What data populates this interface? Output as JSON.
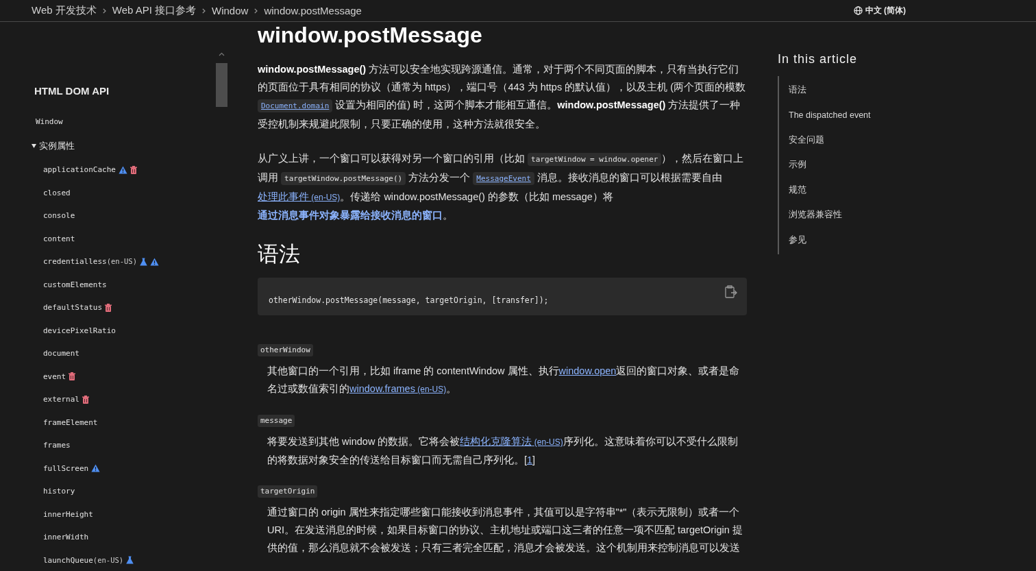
{
  "breadcrumbs": [
    "Web 开发技术",
    "Web API 接口参考",
    "Window",
    "window.postMessage"
  ],
  "language": "中文 (简体)",
  "sidebar": {
    "title": "HTML DOM API",
    "parent": "Window",
    "group": {
      "label": "实例属性",
      "expanded": true,
      "items": [
        {
          "name": "applicationCache",
          "experimental": false,
          "nonstandard": true,
          "deprecated": true
        },
        {
          "name": "closed",
          "experimental": false,
          "nonstandard": false,
          "deprecated": false
        },
        {
          "name": "console",
          "experimental": false,
          "nonstandard": false,
          "deprecated": false
        },
        {
          "name": "content",
          "experimental": false,
          "nonstandard": false,
          "deprecated": false
        },
        {
          "name": "credentialless",
          "note": "(en-US)",
          "experimental": true,
          "nonstandard": true,
          "deprecated": false
        },
        {
          "name": "customElements",
          "experimental": false,
          "nonstandard": false,
          "deprecated": false
        },
        {
          "name": "defaultStatus",
          "experimental": false,
          "nonstandard": false,
          "deprecated": true
        },
        {
          "name": "devicePixelRatio",
          "experimental": false,
          "nonstandard": false,
          "deprecated": false
        },
        {
          "name": "document",
          "experimental": false,
          "nonstandard": false,
          "deprecated": false
        },
        {
          "name": "event",
          "experimental": false,
          "nonstandard": false,
          "deprecated": true
        },
        {
          "name": "external",
          "experimental": false,
          "nonstandard": false,
          "deprecated": true
        },
        {
          "name": "frameElement",
          "experimental": false,
          "nonstandard": false,
          "deprecated": false
        },
        {
          "name": "frames",
          "experimental": false,
          "nonstandard": false,
          "deprecated": false
        },
        {
          "name": "fullScreen",
          "experimental": false,
          "nonstandard": true,
          "deprecated": false
        },
        {
          "name": "history",
          "experimental": false,
          "nonstandard": false,
          "deprecated": false
        },
        {
          "name": "innerHeight",
          "experimental": false,
          "nonstandard": false,
          "deprecated": false
        },
        {
          "name": "innerWidth",
          "experimental": false,
          "nonstandard": false,
          "deprecated": false
        },
        {
          "name": "launchQueue",
          "note": "(en-US)",
          "experimental": true,
          "nonstandard": false,
          "deprecated": false
        }
      ]
    }
  },
  "article": {
    "title": "window.postMessage",
    "intro": [
      [
        {
          "kind": "bold",
          "text": "window.postMessage()"
        },
        {
          "kind": "text",
          "text": " 方法可以安全地实现跨源通信。通常，对于两个不同页面的脚本，只有当执行它们的页面位于具有相同的协议（通常为 https），端口号（443 为 https 的默认值），以及主机 (两个页面的模数 "
        },
        {
          "kind": "codelink",
          "text": "Document.domain"
        },
        {
          "kind": "text",
          "text": " 设置为相同的值) 时，这两个脚本才能相互通信。"
        },
        {
          "kind": "bold",
          "text": "window.postMessage()"
        },
        {
          "kind": "text",
          "text": " 方法提供了一种受控机制来规避此限制，只要正确的使用，这种方法就很安全。"
        }
      ],
      [
        {
          "kind": "text",
          "text": "从广义上讲，一个窗口可以获得对另一个窗口的引用（比如 "
        },
        {
          "kind": "code",
          "text": "targetWindow = window.opener"
        },
        {
          "kind": "text",
          "text": "），然后在窗口上调用 "
        },
        {
          "kind": "code",
          "text": "targetWindow.postMessage()"
        },
        {
          "kind": "text",
          "text": " 方法分发一个 "
        },
        {
          "kind": "codelink",
          "text": "MessageEvent"
        },
        {
          "kind": "text",
          "text": " 消息。接收消息的窗口可以根据需要自由"
        },
        {
          "kind": "link",
          "text": "处理此事件",
          "note": "(en-US)"
        },
        {
          "kind": "text",
          "text": "。传递给 window.postMessage() 的参数（比如 message）将"
        },
        {
          "kind": "boldlink",
          "text": "通过消息事件对象暴露给接收消息的窗口"
        },
        {
          "kind": "text",
          "text": "。"
        }
      ]
    ],
    "section": "语法",
    "code": "otherWindow.postMessage(message, targetOrigin, [transfer]);",
    "params": [
      {
        "name": "otherWindow",
        "segments": [
          {
            "kind": "text",
            "text": "其他窗口的一个引用，比如 iframe 的 contentWindow 属性、执行"
          },
          {
            "kind": "link",
            "text": "window.open"
          },
          {
            "kind": "text",
            "text": "返回的窗口对象、或者是命名过或数值索引的"
          },
          {
            "kind": "link",
            "text": "window.frames",
            "note": "(en-US)"
          },
          {
            "kind": "text",
            "text": "。"
          }
        ]
      },
      {
        "name": "message",
        "segments": [
          {
            "kind": "text",
            "text": "将要发送到其他 window 的数据。它将会被"
          },
          {
            "kind": "link",
            "text": "结构化克隆算法",
            "note": "(en-US)"
          },
          {
            "kind": "text",
            "text": "序列化。这意味着你可以不受什么限制的将数据对象安全的传送给目标窗口而无需自己序列化。["
          },
          {
            "kind": "link",
            "text": "1"
          },
          {
            "kind": "text",
            "text": "]"
          }
        ]
      },
      {
        "name": "targetOrigin",
        "segments": [
          {
            "kind": "text",
            "text": "通过窗口的 origin 属性来指定哪些窗口能接收到消息事件，其值可以是字符串\"*\"（表示无限制）或者一个URI。在发送消息的时候，如果目标窗口的协议、主机地址或端口这三者的任意一项不匹配 targetOrigin 提供的值，那么消息就不会被发送；只有三者完全匹配，消息才会被发送。这个机制用来控制消息可以发送"
          }
        ]
      }
    ]
  },
  "toc": {
    "title": "In this article",
    "items": [
      "语法",
      "The dispatched event",
      "安全问题",
      "示例",
      "规范",
      "浏览器兼容性",
      "参见"
    ]
  }
}
